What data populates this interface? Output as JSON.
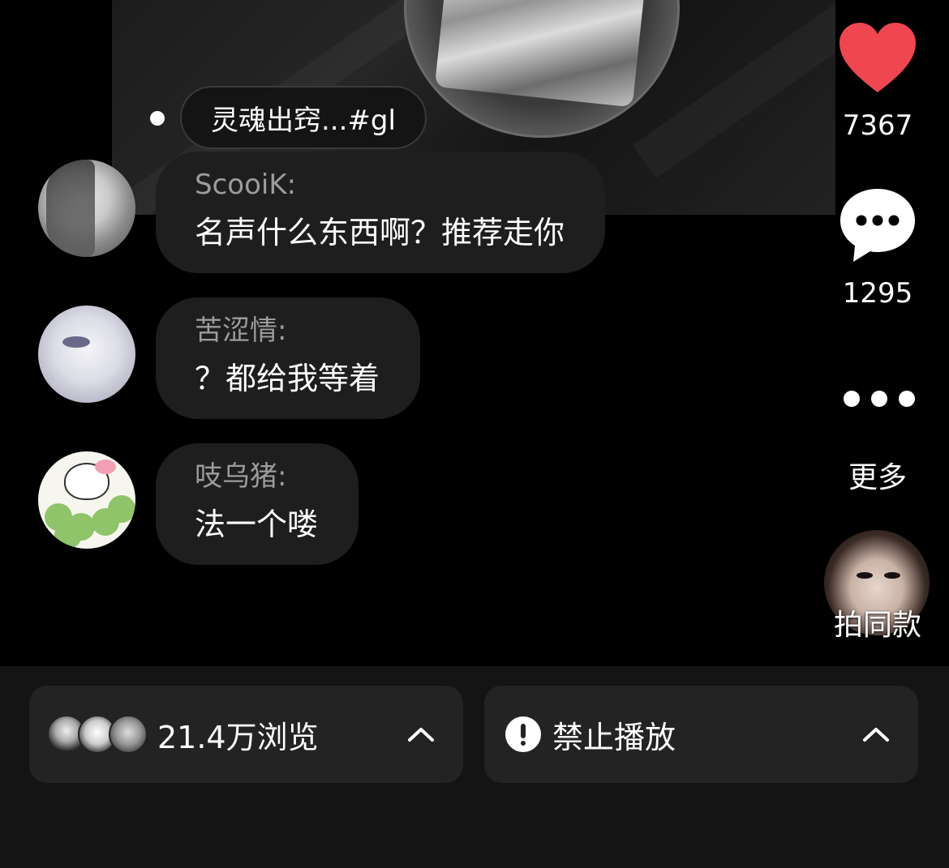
{
  "topic": {
    "label": "灵魂出窍...#gl"
  },
  "comments": [
    {
      "name": "ScooiK:",
      "text": "名声什么东西啊？推荐走你"
    },
    {
      "name": "苦涩情:",
      "text": "？都给我等着"
    },
    {
      "name": "吱乌猪:",
      "text": "法一个喽"
    }
  ],
  "rail": {
    "likes": "7367",
    "comments": "1295",
    "more_label": "更多",
    "same_label": "拍同款",
    "like_color": "#f0464f"
  },
  "bottom": {
    "views_label": "21.4万浏览",
    "ban_label": "禁止播放"
  }
}
